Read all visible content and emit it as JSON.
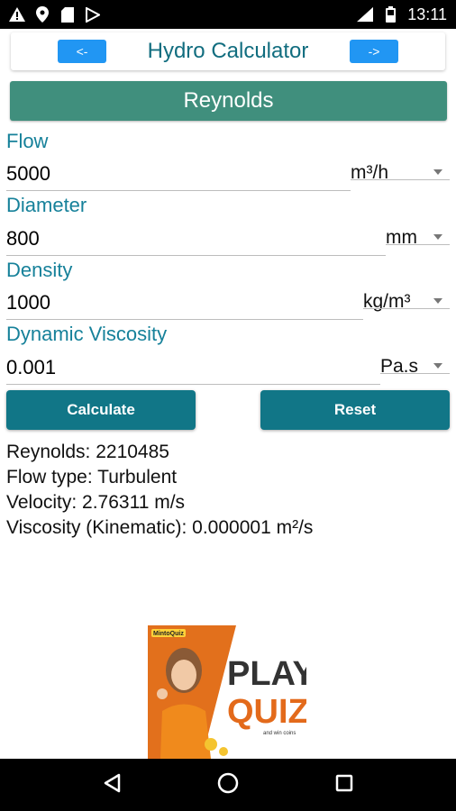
{
  "status_bar": {
    "time": "13:11",
    "left_icons": [
      "warning-icon",
      "location-icon",
      "sd-card-icon",
      "play-store-icon"
    ],
    "right_icons": [
      "signal-icon",
      "battery-icon"
    ]
  },
  "header": {
    "prev_label": "<-",
    "title": "Hydro Calculator",
    "next_label": "->"
  },
  "section": {
    "title": "Reynolds"
  },
  "fields": {
    "flow": {
      "label": "Flow",
      "value": "5000",
      "unit": "m³/h"
    },
    "diameter": {
      "label": "Diameter",
      "value": "800",
      "unit": "mm"
    },
    "density": {
      "label": "Density",
      "value": "1000",
      "unit": "kg/m³"
    },
    "viscosity": {
      "label": "Dynamic Viscosity",
      "value": "0.001",
      "unit": "Pa.s"
    }
  },
  "buttons": {
    "calculate": "Calculate",
    "reset": "Reset"
  },
  "results": {
    "reynolds": "Reynolds: 2210485",
    "flow_type": "Flow type: Turbulent",
    "velocity": "Velocity: 2.76311 m/s",
    "kinematic": "Viscosity (Kinematic): 0.000001 m²/s"
  },
  "ad": {
    "brand": "MintoQuiz",
    "line1": "PLAY",
    "line2": "QUIZ",
    "tagline": "and win coins"
  },
  "colors": {
    "accent": "#117687",
    "section_bar": "#408f7d",
    "nav_button": "#2196f3",
    "label_text": "#16819a"
  }
}
